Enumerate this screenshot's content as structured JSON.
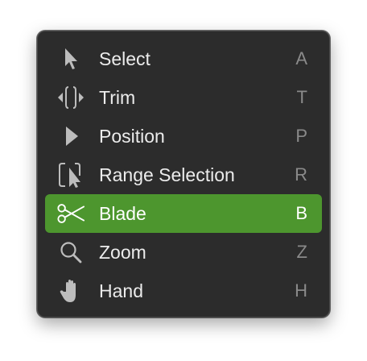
{
  "menu": {
    "items": [
      {
        "label": "Select",
        "shortcut": "A",
        "icon": "arrow-pointer-icon",
        "selected": false
      },
      {
        "label": "Trim",
        "shortcut": "T",
        "icon": "trim-icon",
        "selected": false
      },
      {
        "label": "Position",
        "shortcut": "P",
        "icon": "position-arrow-icon",
        "selected": false
      },
      {
        "label": "Range Selection",
        "shortcut": "R",
        "icon": "range-selection-icon",
        "selected": false
      },
      {
        "label": "Blade",
        "shortcut": "B",
        "icon": "scissors-icon",
        "selected": true
      },
      {
        "label": "Zoom",
        "shortcut": "Z",
        "icon": "magnifier-icon",
        "selected": false
      },
      {
        "label": "Hand",
        "shortcut": "H",
        "icon": "hand-icon",
        "selected": false
      }
    ]
  },
  "colors": {
    "menu_background": "#2c2c2c",
    "selection_highlight": "#4d962e",
    "text": "#ececec",
    "shortcut_text": "#8a8a8a"
  }
}
